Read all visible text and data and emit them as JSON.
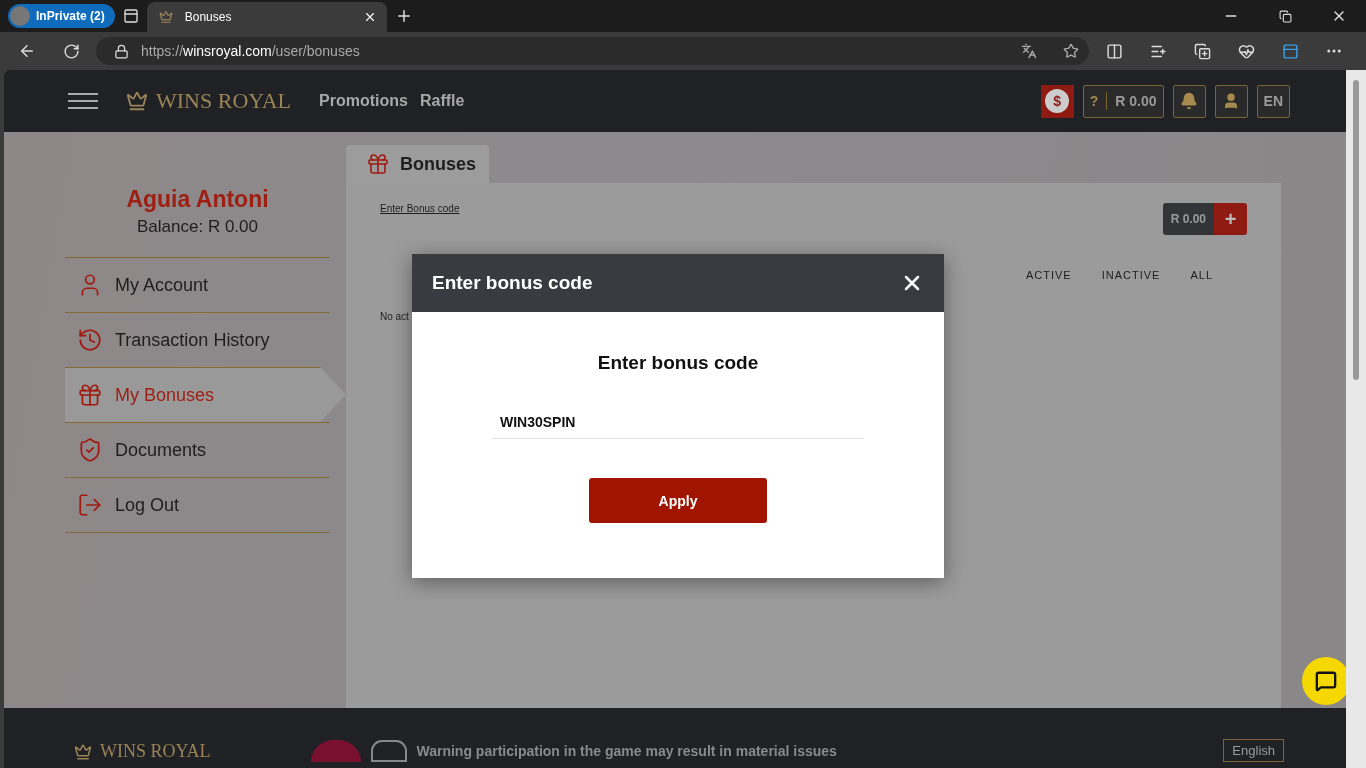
{
  "browser": {
    "profile": "InPrivate (2)",
    "tab": {
      "title": "Bonuses"
    },
    "url": {
      "scheme": "https://",
      "domain": "winsroyal.com",
      "path": "/user/bonuses"
    }
  },
  "header": {
    "logo": "WINS ROYAL",
    "nav": [
      "Promotions",
      "Raffle"
    ],
    "coin": "$",
    "help": "?",
    "balance": "R 0.00",
    "language": "EN"
  },
  "profile": {
    "name": "Aguia Antoni",
    "balance": "Balance: R 0.00"
  },
  "menu": [
    {
      "label": "My Account",
      "kind": "account",
      "selected": false
    },
    {
      "label": "Transaction History",
      "kind": "history",
      "selected": false
    },
    {
      "label": "My Bonuses",
      "kind": "bonuses",
      "selected": true
    },
    {
      "label": "Documents",
      "kind": "documents",
      "selected": false
    },
    {
      "label": "Log Out",
      "kind": "logout",
      "selected": false
    }
  ],
  "content": {
    "tab": "Bonuses",
    "link": "Enter Bonus code",
    "balance": "R 0.00",
    "plus": "+",
    "filters": [
      "ACTIVE",
      "INACTIVE",
      "ALL"
    ],
    "empty_text": "No act"
  },
  "modal": {
    "title": "Enter bonus code",
    "heading": "Enter bonus code",
    "value": "WIN30SPIN",
    "button": "Apply"
  },
  "footer": {
    "logo": "WINS ROYAL",
    "warning": "Warning participation in the game may result in material issues",
    "language": "English"
  }
}
